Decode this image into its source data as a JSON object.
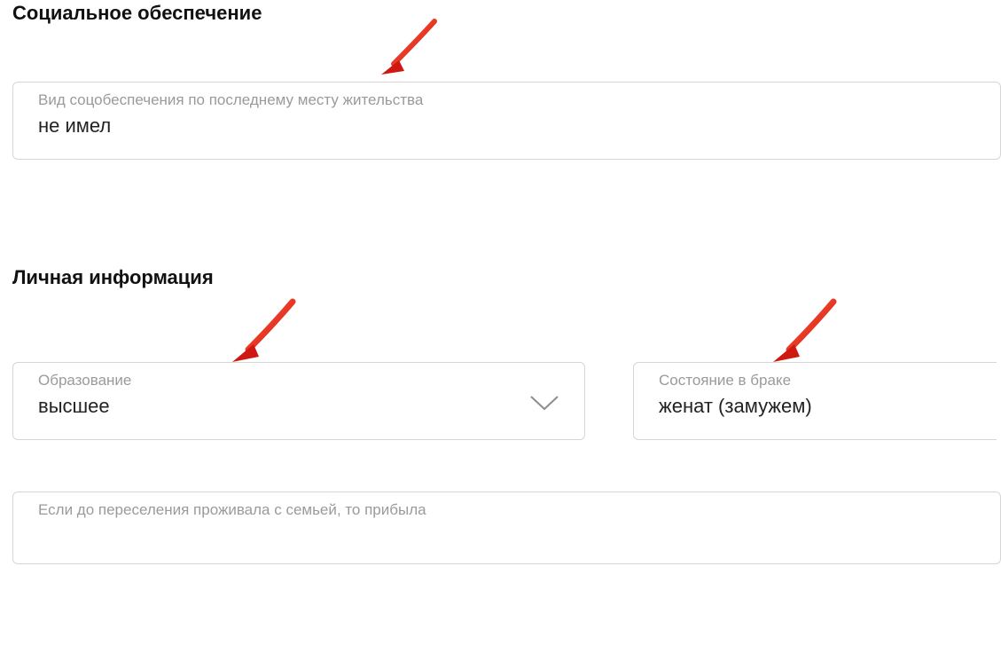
{
  "sections": {
    "social": {
      "heading": "Социальное обеспечение",
      "field": {
        "label": "Вид соцобеспечения по последнему месту жительства",
        "value": "не имел"
      }
    },
    "personal": {
      "heading": "Личная информация",
      "education": {
        "label": "Образование",
        "value": "высшее"
      },
      "marital": {
        "label": "Состояние в браке",
        "value": "женат (замужем)"
      },
      "family": {
        "label": "Если до переселения проживала с семьей, то прибыла",
        "value": ""
      }
    }
  },
  "icons": {
    "chevron": "chevron-down"
  },
  "colors": {
    "arrow": "#e52620",
    "border": "#d6d6d6",
    "label": "#9a9a9a",
    "text": "#222222"
  }
}
